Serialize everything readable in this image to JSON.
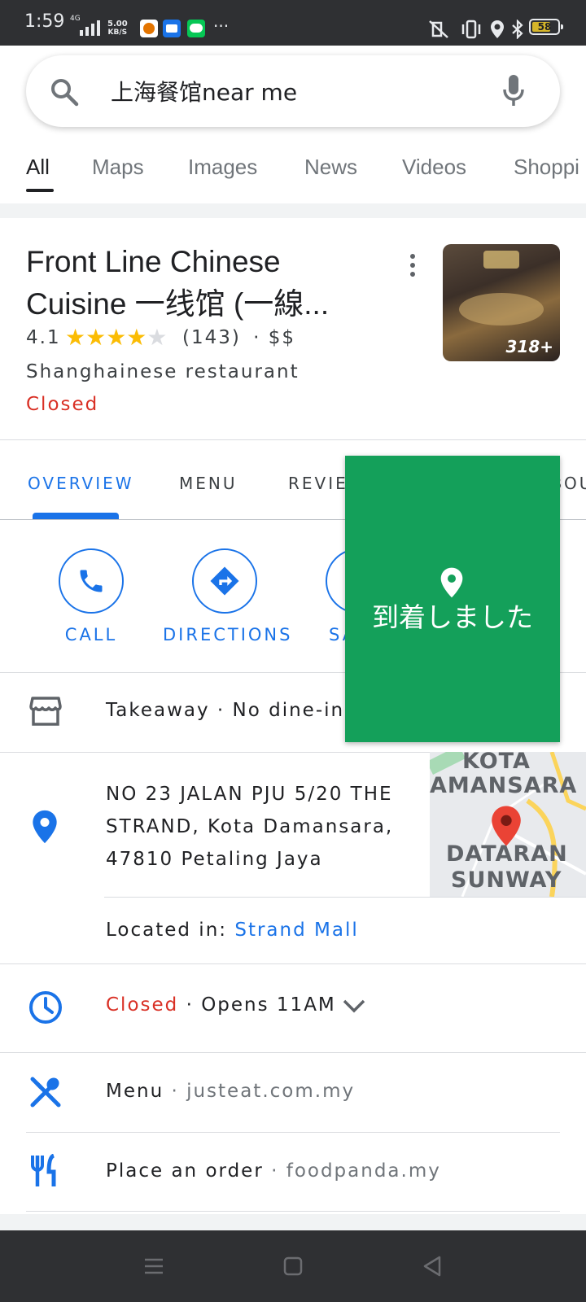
{
  "status_bar": {
    "time": "1:59",
    "network": "4G",
    "speed_value": "5.00",
    "speed_unit": "KB/S",
    "more": "···",
    "battery": "58"
  },
  "search": {
    "query": "上海餐馆near me"
  },
  "tabs": [
    "All",
    "Maps",
    "Images",
    "News",
    "Videos",
    "Shoppi"
  ],
  "place": {
    "name": "Front Line Chinese Cuisine 一线馆 (一線...",
    "rating": "4.1",
    "review_count": "(143)",
    "price": "· $$",
    "category": "Shanghainese restaurant",
    "status": "Closed",
    "photo_count": "318+"
  },
  "section_tabs": [
    "OVERVIEW",
    "MENU",
    "REVIEWS",
    "ABOUT"
  ],
  "actions": {
    "call": "CALL",
    "directions": "DIRECTIONS",
    "save": "SAVE"
  },
  "service_options": "Takeaway · No dine-in",
  "address": {
    "text": "NO 23 JALAN PJU 5/20 THE STRAND, Kota Damansara, 47810 Petaling Jaya",
    "located_prefix": "Located in:",
    "located_link": "Strand Mall",
    "map_labels": [
      "KOTA",
      "AMANSARA",
      "DATARAN",
      "SUNWAY"
    ]
  },
  "hours": {
    "status": "Closed",
    "opens": "· Opens 11AM"
  },
  "menu_row": {
    "label": "Menu",
    "source": "· justeat.com.my"
  },
  "order_row": {
    "label": "Place an order",
    "source": "· foodpanda.my"
  },
  "overlay": {
    "message": "到着しました"
  },
  "colors": {
    "accent": "#1a73e8",
    "closed": "#d93025",
    "star": "#fbbc04",
    "overlay": "#14a05a"
  }
}
